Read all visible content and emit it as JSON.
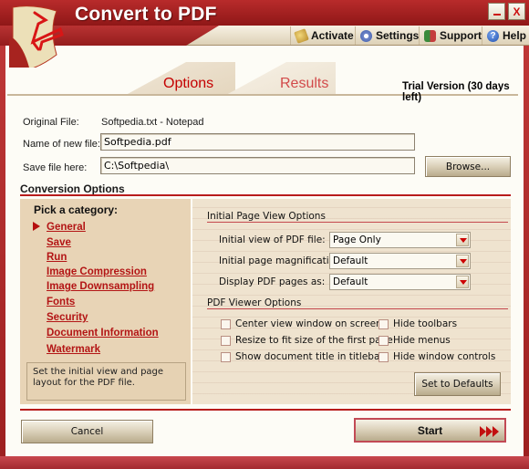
{
  "window": {
    "title": "Convert to PDF",
    "minimize_label": "_",
    "close_label": "X"
  },
  "toolbar": {
    "activate": "Activate",
    "settings": "Settings",
    "support": "Support",
    "help": "Help",
    "help_glyph": "?"
  },
  "tabs": {
    "options": "Options",
    "results": "Results",
    "active": "Options"
  },
  "trial_text": "Trial Version (30 days left)",
  "file": {
    "original_label": "Original File:",
    "original_value": "Softpedia.txt - Notepad",
    "new_name_label": "Name of new  file:",
    "new_name_value": "Softpedia.pdf",
    "save_label": "Save file here:",
    "save_value": "C:\\Softpedia\\",
    "browse_label": "Browse..."
  },
  "conversion": {
    "title": "Conversion Options",
    "pick_title": "Pick a category:",
    "selected_category": "General",
    "categories": [
      "General",
      "Save",
      "Run",
      "Image Compression",
      "Image Downsampling",
      "Fonts",
      "Security",
      "Document Information",
      "Watermark"
    ],
    "description": "Set the initial view and page layout for the PDF file."
  },
  "initial_view": {
    "title": "Initial Page View Options",
    "fields": [
      {
        "label": "Initial view of PDF file:",
        "value": "Page Only"
      },
      {
        "label": "Initial page magnification:",
        "value": "Default"
      },
      {
        "label": "Display PDF pages as:",
        "value": "Default"
      }
    ]
  },
  "viewer": {
    "title": "PDF Viewer Options",
    "checkboxes": [
      {
        "label": "Center view window on screen",
        "checked": false
      },
      {
        "label": "Resize to fit size of the first page",
        "checked": false
      },
      {
        "label": "Show document title in titlebar",
        "checked": false
      },
      {
        "label": "Hide toolbars",
        "checked": false
      },
      {
        "label": "Hide menus",
        "checked": false
      },
      {
        "label": "Hide window controls",
        "checked": false
      }
    ],
    "defaults_label": "Set to Defaults"
  },
  "footer": {
    "cancel_label": "Cancel",
    "start_label": "Start"
  },
  "colors": {
    "brand_red": "#b81c1c",
    "link_red": "#b31515",
    "panel_tan": "#e8d4b6"
  }
}
